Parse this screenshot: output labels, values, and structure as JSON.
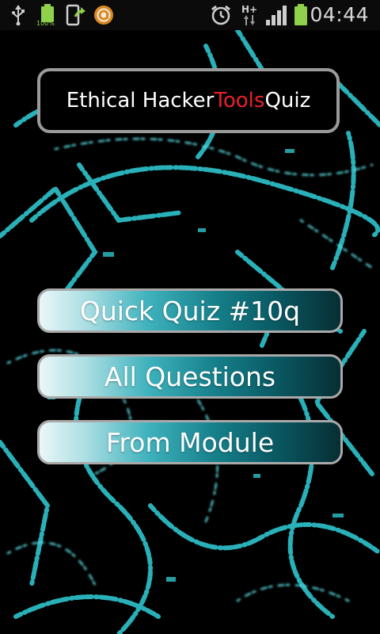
{
  "status_bar": {
    "time": "04:44",
    "battery_percent": "100%",
    "network_type": "H+",
    "icons": [
      "usb-icon",
      "battery-full-icon",
      "phone-update-icon",
      "app-notification-icon",
      "alarm-icon",
      "network-data-icon",
      "signal-bars-icon",
      "battery-icon"
    ],
    "colors": {
      "battery": "#8fd14a",
      "orange_app": "#d88a24"
    }
  },
  "title": {
    "part1": "Ethical Hacker ",
    "accent": "Tools",
    "part2": " Quiz",
    "accent_color": "#e8202a"
  },
  "menu": {
    "quick_quiz": "Quick Quiz #10q",
    "all_questions": "All Questions",
    "from_module": "From Module"
  },
  "theme": {
    "background": "#000000",
    "graffiti_color": "#2ec4cc",
    "button_border": "#a9a9a9"
  }
}
